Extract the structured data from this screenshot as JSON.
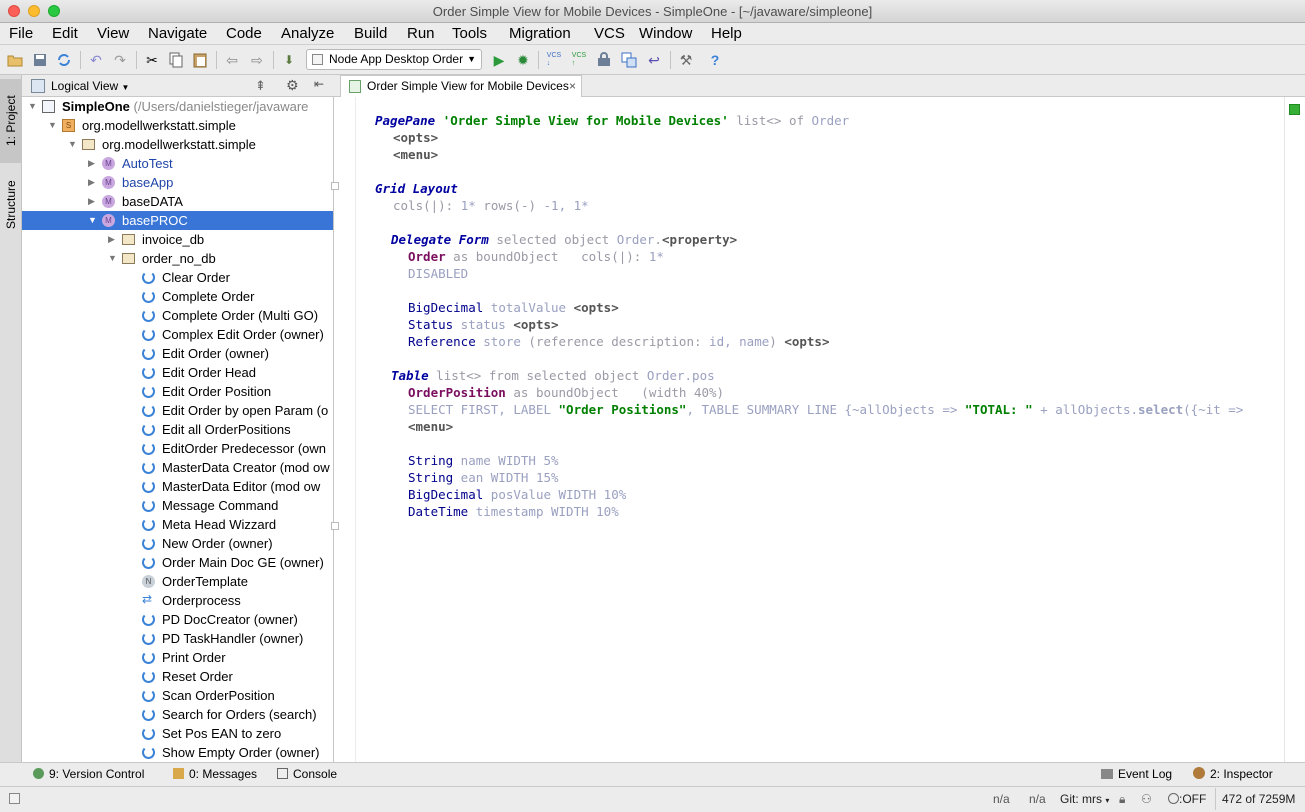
{
  "window": {
    "title": "Order Simple View for Mobile Devices - SimpleOne - [~/javaware/simpleone]"
  },
  "menu": [
    "File",
    "Edit",
    "View",
    "Navigate",
    "Code",
    "Analyze",
    "Build",
    "Run",
    "Tools",
    "Migration",
    "VCS",
    "Window",
    "Help"
  ],
  "toolbar": {
    "run_config": "Node App Desktop Order"
  },
  "left_tabs": {
    "project": "1: Project",
    "structure": "Structure"
  },
  "project_panel": {
    "view": "Logical View"
  },
  "tree": [
    {
      "label": "SimpleOne",
      "suffix": " (/Users/danielstieger/javaware",
      "icon": "project-icon"
    },
    {
      "label": "org.modellwerkstatt.simple",
      "icon": "source-icon"
    },
    {
      "label": "org.modellwerkstatt.simple",
      "icon": "folder-icon"
    },
    {
      "label": "AutoTest",
      "icon": "module-icon"
    },
    {
      "label": "baseApp",
      "icon": "module-icon"
    },
    {
      "label": "baseDATA",
      "icon": "module-icon"
    },
    {
      "label": "basePROC",
      "icon": "module-icon"
    },
    {
      "label": "invoice_db",
      "icon": "folder-icon"
    },
    {
      "label": "order_no_db",
      "icon": "folder-icon"
    },
    {
      "label": "Clear Order",
      "icon": "process-icon"
    },
    {
      "label": "Complete Order",
      "icon": "process-icon"
    },
    {
      "label": "Complete Order (Multi GO)",
      "icon": "process-icon"
    },
    {
      "label": "Complex Edit Order (owner)",
      "icon": "process-icon"
    },
    {
      "label": "Edit Order (owner)",
      "icon": "process-icon"
    },
    {
      "label": "Edit Order Head",
      "icon": "process-icon"
    },
    {
      "label": "Edit Order Position",
      "icon": "process-icon"
    },
    {
      "label": "Edit Order by open Param (o",
      "icon": "process-icon"
    },
    {
      "label": "Edit all OrderPositions",
      "icon": "process-icon"
    },
    {
      "label": "EditOrder Predecessor (own",
      "icon": "process-icon"
    },
    {
      "label": "MasterData Creator (mod ow",
      "icon": "process-icon"
    },
    {
      "label": "MasterData Editor (mod ow",
      "icon": "process-icon"
    },
    {
      "label": "Message Command",
      "icon": "process-icon"
    },
    {
      "label": "Meta Head Wizzard",
      "icon": "process-icon"
    },
    {
      "label": "New Order (owner)",
      "icon": "process-icon"
    },
    {
      "label": "Order Main Doc GE (owner)",
      "icon": "process-icon"
    },
    {
      "label": "OrderTemplate",
      "icon": "node-icon"
    },
    {
      "label": "Orderprocess",
      "icon": "orderprocess-icon"
    },
    {
      "label": "PD DocCreator (owner)",
      "icon": "process-icon"
    },
    {
      "label": "PD TaskHandler (owner)",
      "icon": "process-icon"
    },
    {
      "label": "Print Order",
      "icon": "process-icon"
    },
    {
      "label": "Reset Order",
      "icon": "process-icon"
    },
    {
      "label": "Scan OrderPosition",
      "icon": "process-icon"
    },
    {
      "label": "Search for Orders (search)",
      "icon": "process-icon"
    },
    {
      "label": "Set Pos EAN to zero",
      "icon": "process-icon"
    },
    {
      "label": "Show Empty Order (owner)",
      "icon": "process-icon"
    }
  ],
  "editor_tab": {
    "label": "Order Simple View for Mobile Devices"
  },
  "code": {
    "l1": {
      "kw": "PagePane",
      "str": "'Order Simple View for Mobile Devices'",
      "rest": " list<> of ",
      "type": "Order"
    },
    "l2": "<opts>",
    "l3": "<menu>",
    "l5": "Grid Layout",
    "l6": {
      "a": "cols(|): ",
      "b": "1*",
      "c": " rows(-) ",
      "d": "-1, 1*"
    },
    "l8": {
      "kw": "Delegate Form",
      "a": " selected object ",
      "b": "Order",
      "c": ".",
      "d": "<property>"
    },
    "l9": {
      "a": "Order",
      "b": " as boundObject   cols(|): ",
      "c": "1*"
    },
    "l10": "DISABLED",
    "l12": {
      "a": "BigDecimal",
      "b": " totalValue ",
      "c": "<opts>"
    },
    "l13": {
      "a": "Status",
      "b": " status ",
      "c": "<opts>"
    },
    "l14": {
      "a": "Reference",
      "b": " store ",
      "c": "(reference description: ",
      "d": "id, name",
      "e": ") ",
      "f": "<opts>"
    },
    "l16": {
      "kw": "Table",
      "a": " list<> from selected object ",
      "b": "Order.pos"
    },
    "l17": {
      "a": "OrderPosition",
      "b": " as boundObject   (width 40%)"
    },
    "l18": {
      "a": "SELECT FIRST, LABEL ",
      "b": "\"Order Positions\"",
      "c": ", TABLE SUMMARY LINE {~allObjects => ",
      "d": "\"TOTAL: \"",
      "e": " + allObjects.",
      "f": "select",
      "g": "({~it =>"
    },
    "l19": "<menu>",
    "l21": {
      "a": "String",
      "b": " name WIDTH 5%"
    },
    "l22": {
      "a": "String",
      "b": " ean WIDTH 15%"
    },
    "l23": {
      "a": "BigDecimal",
      "b": " posValue WIDTH 10%"
    },
    "l24": {
      "a": "DateTime",
      "b": " timestamp WIDTH 10%"
    }
  },
  "tool_windows": {
    "version_control": "9: Version Control",
    "messages": "0: Messages",
    "console": "Console",
    "event_log": "Event Log",
    "inspector": "2: Inspector"
  },
  "status": {
    "na1": "n/a",
    "na2": "n/a",
    "git": "Git: mrs",
    "off": ":OFF",
    "memory": "472 of 7259M"
  }
}
